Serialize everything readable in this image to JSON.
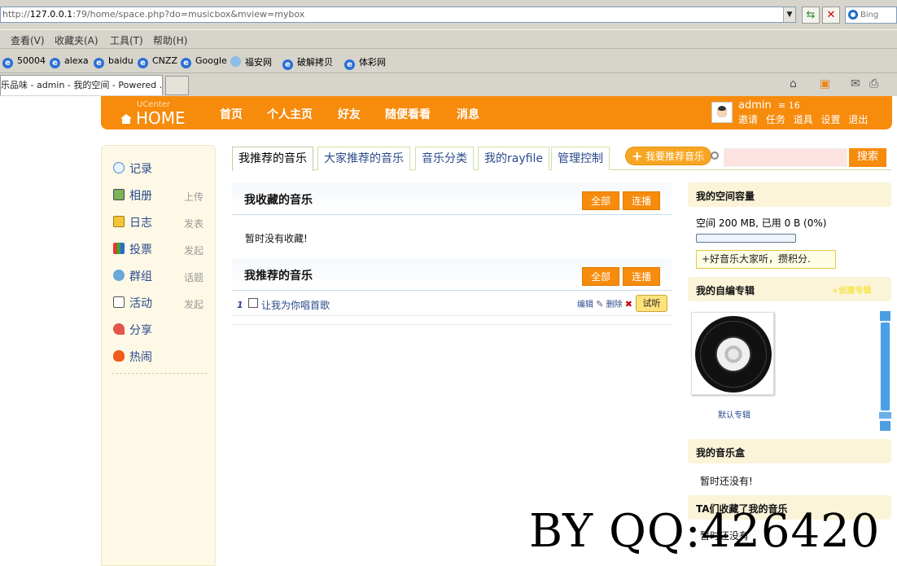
{
  "browser": {
    "address_prefix": "http://",
    "address_host": "127.0.0.1",
    "address_rest": ":79/home/space.php?do=musicbox&mview=mybox",
    "search_placeholder": "Bing",
    "menu": [
      "查看(V)",
      "收藏夹(A)",
      "工具(T)",
      "帮助(H)"
    ],
    "favorites": [
      "50004",
      "alexa",
      "baidu",
      "CNZZ",
      "Google",
      "福安网",
      "破解拷贝",
      "体彩网"
    ],
    "tab_title": "乐品味 - admin - 我的空间 - Powered ..."
  },
  "header": {
    "logo_small": "UCenter",
    "logo_big": "HOME",
    "nav": [
      "首页",
      "个人主页",
      "好友",
      "随便看看",
      "消息"
    ],
    "user_name": "admin",
    "user_points": "16",
    "user_links": [
      "邀请",
      "任务",
      "道具",
      "设置",
      "退出"
    ]
  },
  "sidebar": {
    "items": [
      {
        "label": "记录",
        "sub": ""
      },
      {
        "label": "相册",
        "sub": "上传"
      },
      {
        "label": "日志",
        "sub": "发表"
      },
      {
        "label": "投票",
        "sub": "发起"
      },
      {
        "label": "群组",
        "sub": "话题"
      },
      {
        "label": "活动",
        "sub": "发起"
      },
      {
        "label": "分享",
        "sub": ""
      },
      {
        "label": "热闹",
        "sub": ""
      }
    ]
  },
  "tabs": [
    "我推荐的音乐",
    "大家推荐的音乐",
    "音乐分类",
    "我的rayfile",
    "管理控制"
  ],
  "recommend_button": "我要推荐音乐",
  "search_button": "搜索",
  "collected": {
    "title": "我收藏的音乐",
    "all_label": "全部",
    "play_label": "连播",
    "empty": "暂时没有收藏!"
  },
  "recommended": {
    "title": "我推荐的音乐",
    "all_label": "全部",
    "play_label": "连播",
    "songs": [
      {
        "num": "1",
        "title": "让我为你唱首歌",
        "edit": "编辑",
        "delete": "删除",
        "try": "试听"
      }
    ]
  },
  "right": {
    "capacity_title": "我的空间容量",
    "capacity_text": "空间  200 MB, 已用  0 B (0%)",
    "capacity_fraction": 0.0,
    "capacity_note": "+好音乐大家听，攒积分.",
    "album_title": "我的自编专辑",
    "album_link": "+创建专辑",
    "album_caption": "默认专辑",
    "musicbox_title": "我的音乐盒",
    "musicbox_empty": "暂时还没有!",
    "ta_title": "TA们收藏了我的音乐",
    "ta_empty": "暂时还没有"
  },
  "watermark": "BY QQ:426420",
  "colors": {
    "accent": "#f68b0c",
    "link": "#2b4a8c",
    "sidebar_bg": "#fdf9e6"
  }
}
